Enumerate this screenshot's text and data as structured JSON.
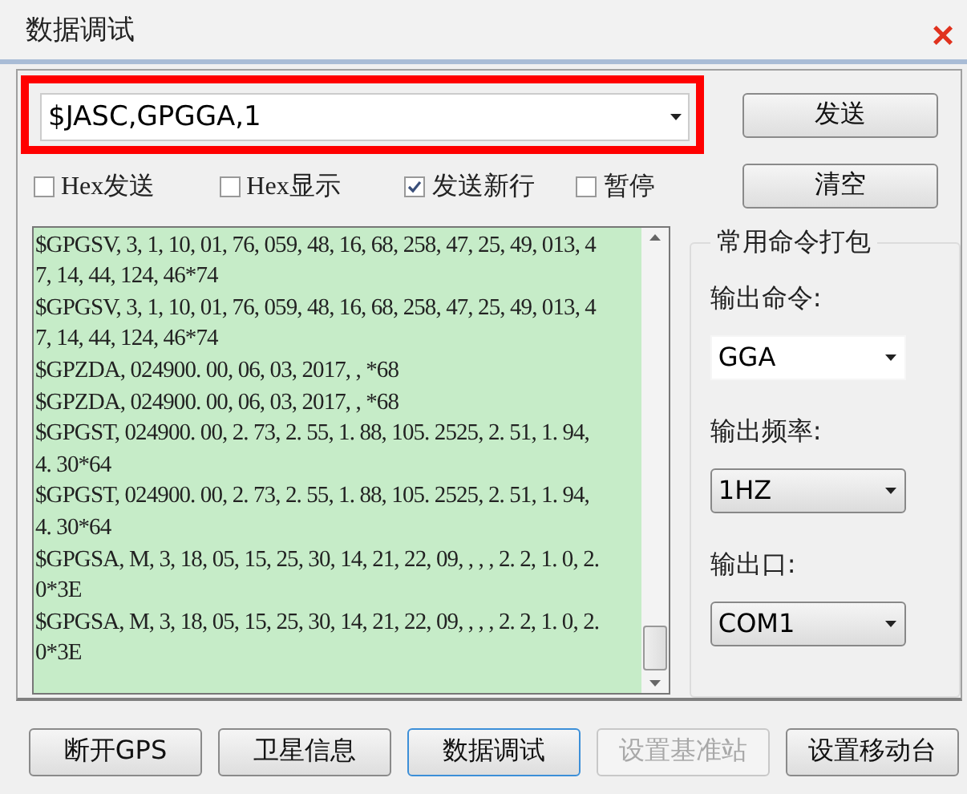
{
  "window": {
    "title": "数据调试",
    "close_glyph": "×"
  },
  "command": {
    "value": "$JASC,GPGGA,1",
    "highlighted": true
  },
  "side_buttons": [
    "发送",
    "清空"
  ],
  "options": [
    {
      "label": "Hex发送",
      "checked": false
    },
    {
      "label": "Hex显示",
      "checked": false
    },
    {
      "label": "发送新行",
      "checked": true
    },
    {
      "label": "暂停",
      "checked": false
    }
  ],
  "log": {
    "lines": [
      "$GPGSV, 3, 1, 10, 01, 76, 059, 48, 16, 68, 258, 47, 25, 49, 013, 4",
      "7, 14, 44, 124, 46*74",
      "$GPGSV, 3, 1, 10, 01, 76, 059, 48, 16, 68, 258, 47, 25, 49, 013, 4",
      "7, 14, 44, 124, 46*74",
      "$GPZDA, 024900. 00, 06, 03, 2017, , *68",
      "$GPZDA, 024900. 00, 06, 03, 2017, , *68",
      "$GPGST, 024900. 00, 2. 73, 2. 55, 1. 88, 105. 2525, 2. 51, 1. 94,",
      "4. 30*64",
      "$GPGST, 024900. 00, 2. 73, 2. 55, 1. 88, 105. 2525, 2. 51, 1. 94,",
      "4. 30*64",
      "$GPGSA, M, 3, 18, 05, 15, 25, 30, 14, 21, 22, 09, , , , 2. 2, 1. 0, 2.",
      "0*3E",
      "$GPGSA, M, 3, 18, 05, 15, 25, 30, 14, 21, 22, 09, , , , 2. 2, 1. 0, 2.",
      "0*3E"
    ]
  },
  "group": {
    "title": "常用命令打包",
    "fields": [
      {
        "label": "输出命令:",
        "value": "GGA",
        "kind": "edit"
      },
      {
        "label": "输出频率:",
        "value": "1HZ",
        "kind": "list"
      },
      {
        "label": "输出口:",
        "value": "COM1",
        "kind": "list"
      }
    ]
  },
  "nav_buttons": [
    {
      "label": "断开GPS",
      "selected": false,
      "disabled": false
    },
    {
      "label": "卫星信息",
      "selected": false,
      "disabled": false
    },
    {
      "label": "数据调试",
      "selected": true,
      "disabled": false
    },
    {
      "label": "设置基准站",
      "selected": false,
      "disabled": true
    },
    {
      "label": "设置移动台",
      "selected": false,
      "disabled": false
    }
  ]
}
